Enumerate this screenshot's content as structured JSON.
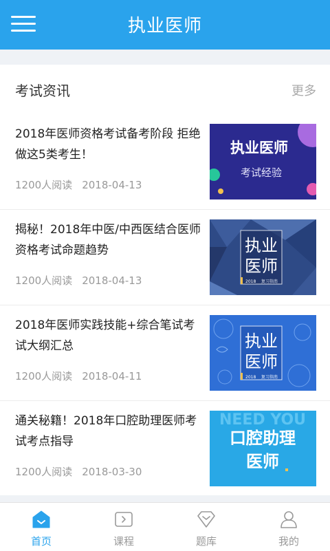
{
  "header": {
    "title": "执业医师",
    "menu_icon": "hamburger-menu-icon"
  },
  "section": {
    "title": "考试资讯",
    "more_label": "更多"
  },
  "articles": [
    {
      "title": "2018年医师资格考试备考阶段 拒绝做这5类考生！",
      "reads": "1200人阅读",
      "date": "2018-04-13",
      "thumb": {
        "line1": "执业医师",
        "line2": "考试经验"
      }
    },
    {
      "title": "揭秘！2018年中医/中西医结合医师资格考试命题趋势",
      "reads": "1200人阅读",
      "date": "2018-04-13",
      "thumb": {
        "line1": "执业",
        "line2": "医师",
        "year": "2018",
        "sub": "复习指南"
      }
    },
    {
      "title": "2018年医师实践技能+综合笔试考试大纲汇总",
      "reads": "1200人阅读",
      "date": "2018-04-11",
      "thumb": {
        "line1": "执业",
        "line2": "医师",
        "year": "2018",
        "sub": "复习指南"
      }
    },
    {
      "title": "通关秘籍！2018年口腔助理医师考试考点指导",
      "reads": "1200人阅读",
      "date": "2018-03-30",
      "thumb": {
        "line1": "口腔助理",
        "line2": "医师",
        "bg_text": "NEED YOU"
      }
    }
  ],
  "tabs": [
    {
      "label": "首页",
      "icon": "home-icon",
      "active": true
    },
    {
      "label": "课程",
      "icon": "course-icon",
      "active": false
    },
    {
      "label": "题库",
      "icon": "question-bank-icon",
      "active": false
    },
    {
      "label": "我的",
      "icon": "profile-icon",
      "active": false
    }
  ],
  "colors": {
    "primary": "#2aa3ec",
    "inactive": "#999999"
  }
}
